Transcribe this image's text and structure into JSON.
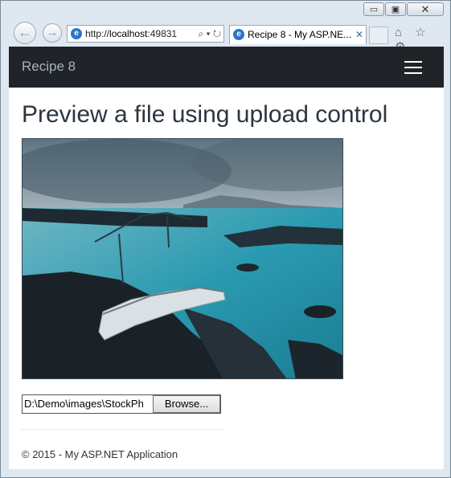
{
  "browser": {
    "window_controls": {
      "minimize": "▭",
      "maximize": "▣",
      "close": "✕"
    },
    "back_glyph": "←",
    "forward_glyph": "→",
    "address": {
      "prefix": "http://",
      "host": "localhost",
      "port_fragment": ":49831",
      "tools": "⌕ ▾ ↻"
    },
    "tab": {
      "title": "Recipe 8 - My ASP.NE...",
      "close": "✕"
    },
    "toolbar_icons": [
      "home-icon",
      "star-icon",
      "gear-icon"
    ],
    "toolbar_glyphs": "⌂ ☆ ⚙"
  },
  "app": {
    "brand": "Recipe 8",
    "heading": "Preview a file using upload control",
    "file_input": {
      "path": "D:\\Demo\\images\\StockPh",
      "button": "Browse..."
    },
    "footer": "© 2015 - My ASP.NET Application"
  },
  "colors": {
    "navbar_bg": "#202429",
    "brand_text": "#a9b4be",
    "heading_text": "#2b3540"
  }
}
